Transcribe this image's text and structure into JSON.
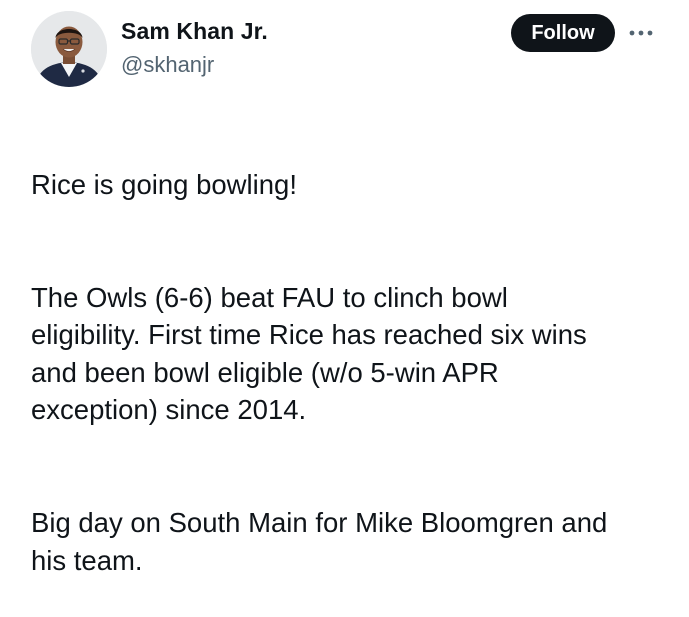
{
  "post": {
    "author": {
      "name": "Sam Khan Jr.",
      "handle": "@skhanjr",
      "avatar_icon": "profile-photo"
    },
    "actions": {
      "follow_label": "Follow",
      "more_icon": "more-horizontal-icon"
    },
    "body": {
      "paragraphs": [
        "Rice is going bowling!",
        "The Owls (6-6) beat FAU to clinch bowl\neligibility. First time Rice has reached six wins\nand been bowl eligible (w/o 5-win APR\nexception) since 2014.",
        "Big day on South Main for Mike Bloomgren and\nhis team."
      ]
    }
  },
  "colors": {
    "text_primary": "#0f1419",
    "text_secondary": "#536471",
    "button_bg": "#0f1419",
    "button_text": "#ffffff",
    "background": "#ffffff"
  }
}
